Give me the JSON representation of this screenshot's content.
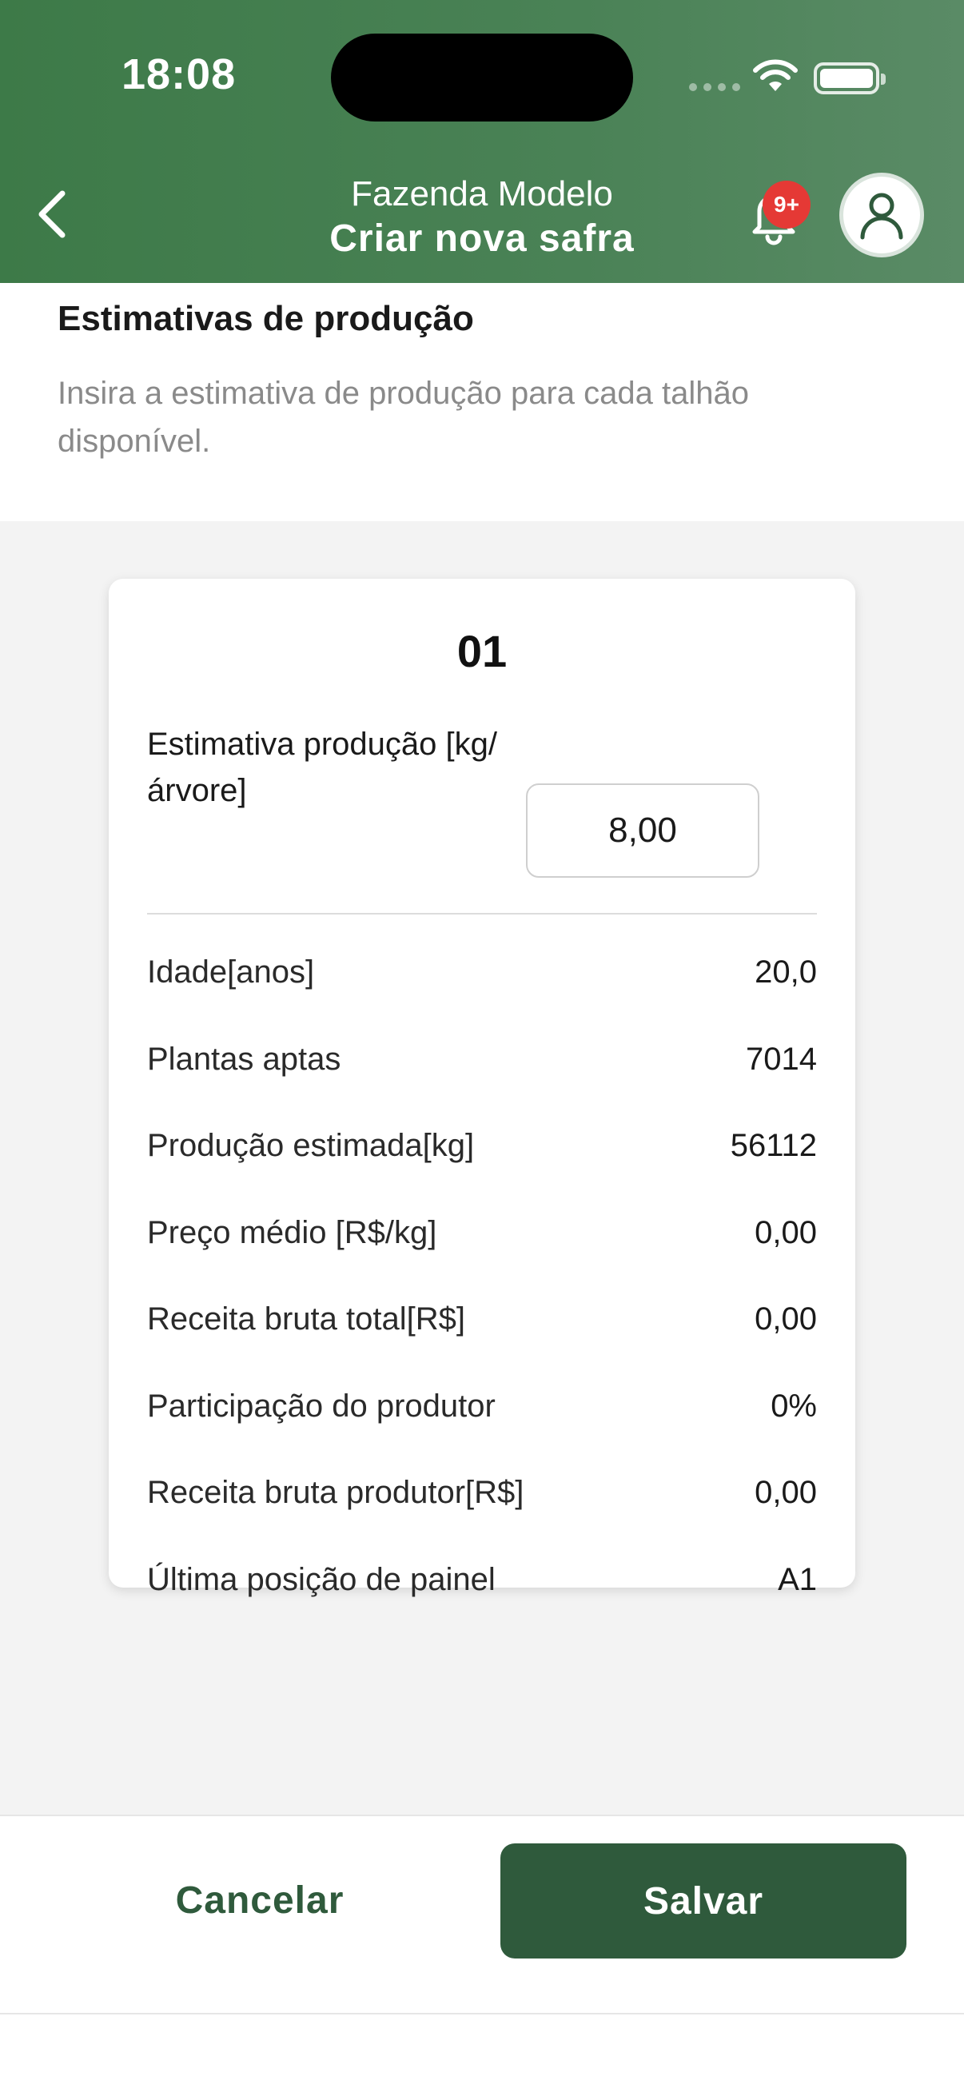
{
  "status_bar": {
    "time": "18:08"
  },
  "header": {
    "farm_name": "Fazenda Modelo",
    "title": "Criar nova safra",
    "notifications_badge": "9+",
    "icons": {
      "back": "chevron-left-icon",
      "bell": "bell-icon",
      "user": "user-icon"
    }
  },
  "intro": {
    "title": "Estimativas de produção",
    "description": "Insira a estimativa de produção para cada talhão disponível."
  },
  "card": {
    "title": "01",
    "estimate_label": "Estimativa produção [kg/árvore]",
    "estimate_value": "8,00",
    "rows": [
      {
        "label": "Idade[anos]",
        "value": "20,0"
      },
      {
        "label": "Plantas aptas",
        "value": "7014"
      },
      {
        "label": "Produção estimada[kg]",
        "value": "56112"
      },
      {
        "label": "Preço médio [R$/kg]",
        "value": "0,00"
      },
      {
        "label": "Receita bruta total[R$]",
        "value": "0,00"
      },
      {
        "label": "Participação do produtor",
        "value": "0%"
      },
      {
        "label": "Receita bruta produtor[R$]",
        "value": "0,00"
      },
      {
        "label": "Última posição de painel",
        "value": "A1"
      }
    ]
  },
  "footer": {
    "cancel_label": "Cancelar",
    "save_label": "Salvar"
  },
  "colors": {
    "header_green": "#3d7a48",
    "primary": "#2f5a3c",
    "badge": "#e53935",
    "muted_text": "#8a8a8a"
  }
}
